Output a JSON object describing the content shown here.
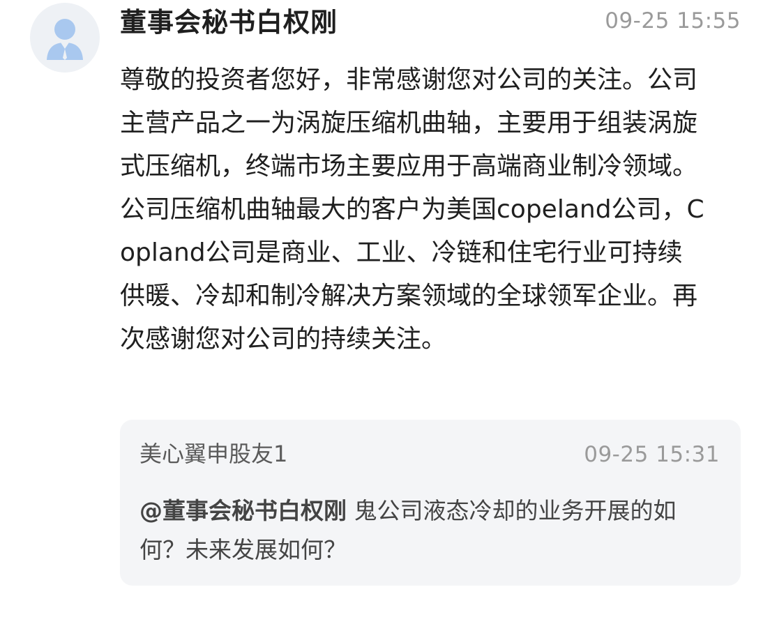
{
  "reply": {
    "author": "董事会秘书白权刚",
    "time": "09-25 15:55",
    "text": "尊敬的投资者您好，非常感谢您对公司的关注。公司主营产品之一为涡旋压缩机曲轴，主要用于组装涡旋式压缩机，终端市场主要应用于高端商业制冷领域。公司压缩机曲轴最大的客户为美国copeland公司，Copland公司是商业、工业、冷链和住宅行业可持续供暖、冷却和制冷解决方案领域的全球领军企业。再次感谢您对公司的持续关注。",
    "avatar_icon": "user-avatar-icon"
  },
  "question": {
    "user": "美心翼申股友1",
    "time": "09-25 15:31",
    "mention": "@董事会秘书白权刚",
    "text": "鬼公司液态冷却的业务开展的如何？未来发展如何？"
  },
  "colors": {
    "avatar_bg": "#eef1f5",
    "avatar_fg": "#a9c8ef",
    "quote_bg": "#f4f5f7",
    "muted": "#9a9a9a"
  }
}
